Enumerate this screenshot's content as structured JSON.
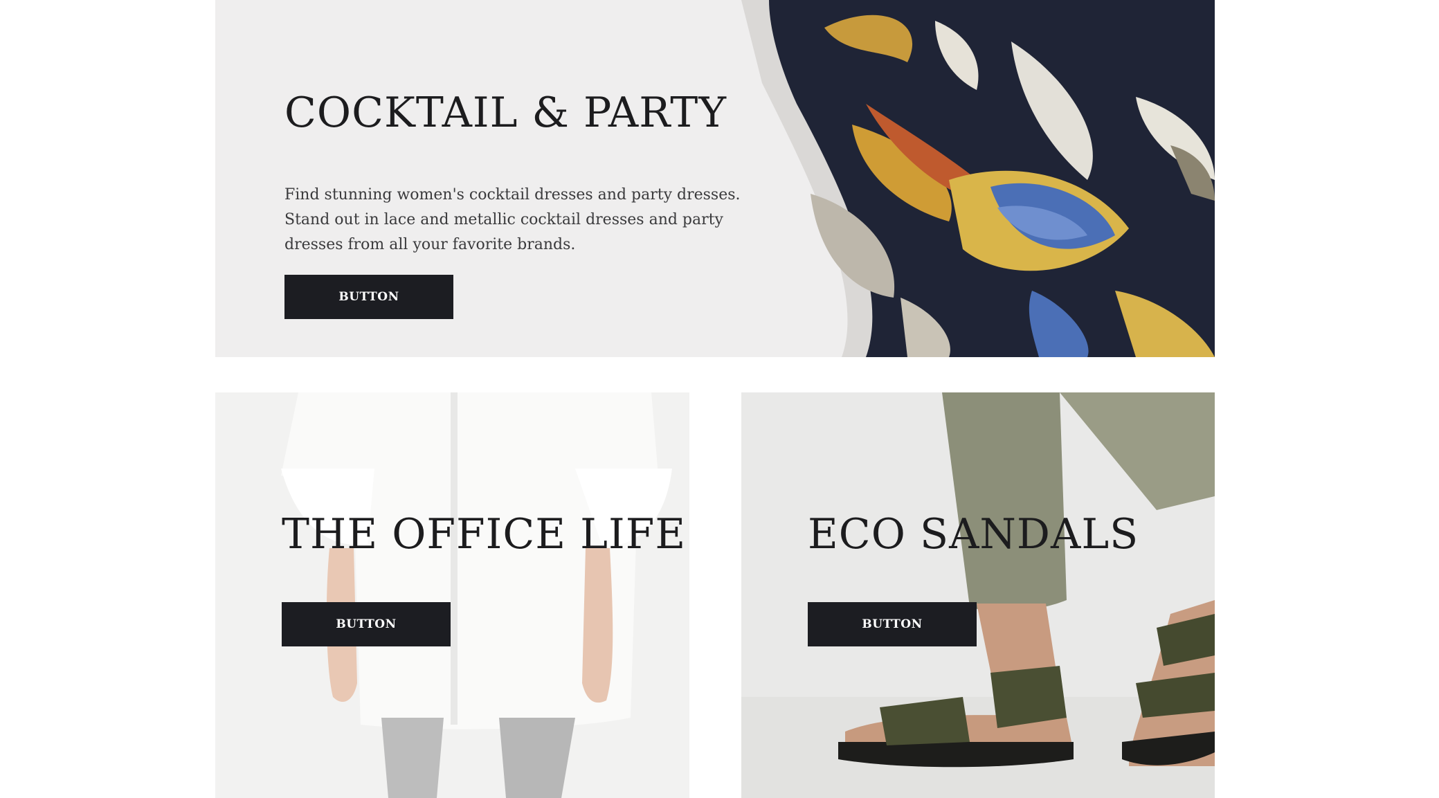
{
  "hero": {
    "title": "COCKTAIL & PARTY",
    "description": "Find stunning women's cocktail dresses and party dresses. Stand out in lace and metallic cocktail dresses and party dresses from all your favorite brands.",
    "button_label": "BUTTON",
    "image": "floral-print-fabric"
  },
  "tiles": [
    {
      "title": "THE OFFICE LIFE",
      "button_label": "BUTTON",
      "image": "white-shirt-model"
    },
    {
      "title": "ECO SANDALS",
      "button_label": "BUTTON",
      "image": "green-strap-sandals"
    }
  ],
  "colors": {
    "button_bg": "#1c1d22",
    "button_text": "#ffffff",
    "heading_text": "#1c1c1e",
    "banner_bg": "#efeeee",
    "page_bg": "#ffffff"
  }
}
